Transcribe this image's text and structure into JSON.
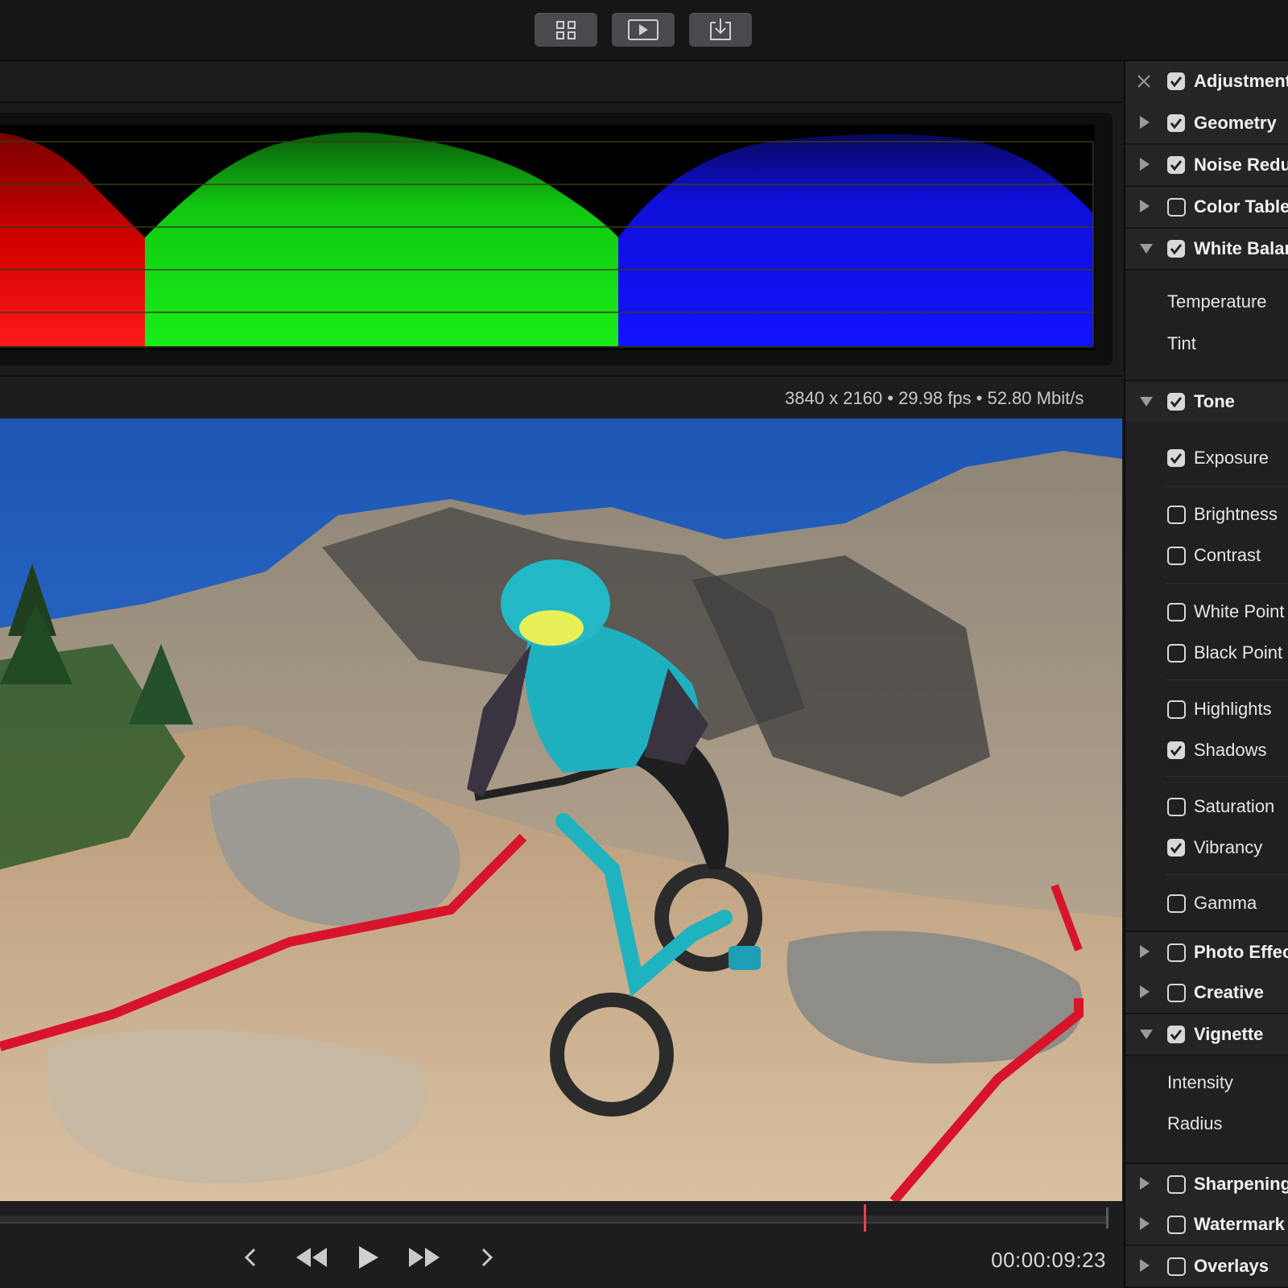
{
  "toolbar": {
    "buttons": [
      {
        "name": "grid-view",
        "icon": "grid-icon"
      },
      {
        "name": "play-preview",
        "icon": "play-box-icon"
      },
      {
        "name": "export",
        "icon": "import-tray-icon"
      }
    ]
  },
  "video_info": "3840 x 2160 • 29.98 fps • 52.80 Mbit/s",
  "timeline": {
    "timecode": "00:00:09:23",
    "playhead_fraction": 0.78
  },
  "scope": {
    "type": "rgb-parade",
    "channels": [
      "red",
      "green",
      "blue"
    ],
    "colors": {
      "red": "#ff1414",
      "green": "#16e416",
      "blue": "#1010ff"
    }
  },
  "panel": {
    "header": {
      "label": "Adjustments",
      "checked": true
    },
    "sections": [
      {
        "label": "Geometry",
        "checked": true,
        "expanded": false
      },
      {
        "label": "Noise Reduction",
        "checked": true,
        "expanded": false
      },
      {
        "label": "Color Table",
        "checked": false,
        "expanded": false
      },
      {
        "label": "White Balance",
        "checked": true,
        "expanded": true,
        "items": [
          "Temperature",
          "Tint"
        ]
      },
      {
        "label": "Tone",
        "checked": true,
        "expanded": true,
        "items": [
          {
            "label": "Exposure",
            "checked": true
          },
          {
            "label": "Brightness",
            "checked": false
          },
          {
            "label": "Contrast",
            "checked": false
          },
          {
            "label": "White Point",
            "checked": false
          },
          {
            "label": "Black Point",
            "checked": false
          },
          {
            "label": "Highlights",
            "checked": false
          },
          {
            "label": "Shadows",
            "checked": true
          },
          {
            "label": "Saturation",
            "checked": false
          },
          {
            "label": "Vibrancy",
            "checked": true
          },
          {
            "label": "Gamma",
            "checked": false
          }
        ]
      },
      {
        "label": "Photo Effects",
        "checked": false,
        "expanded": false
      },
      {
        "label": "Creative",
        "checked": false,
        "expanded": false
      },
      {
        "label": "Vignette",
        "checked": true,
        "expanded": true,
        "items": [
          "Intensity",
          "Radius"
        ]
      },
      {
        "label": "Sharpening",
        "checked": false,
        "expanded": false
      },
      {
        "label": "Watermark",
        "checked": false,
        "expanded": false
      },
      {
        "label": "Overlays",
        "checked": false,
        "expanded": false
      }
    ]
  },
  "colors": {
    "accent_playhead": "#ef3f4e",
    "panel_bg": "#232325",
    "toolbar_button": "#4a4a4e"
  }
}
